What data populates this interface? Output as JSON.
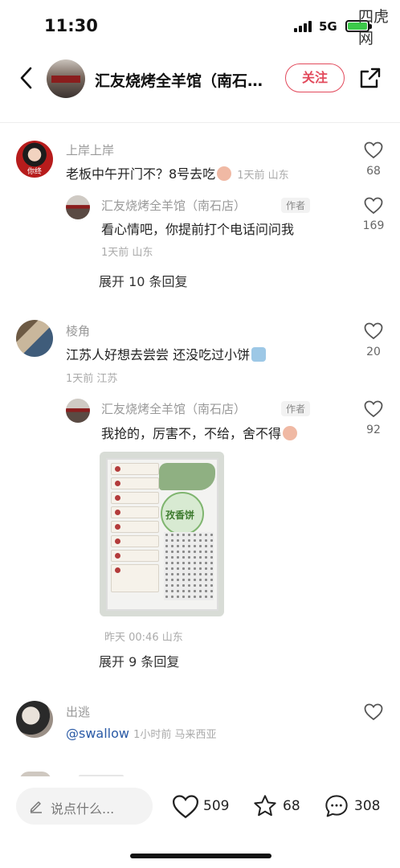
{
  "status_bar": {
    "time": "11:30",
    "network": "5G"
  },
  "watermark": "四虎网",
  "header": {
    "title": "汇友烧烤全羊馆（南石…",
    "follow_label": "关注"
  },
  "comments": [
    {
      "username": "上岸上岸",
      "avatar_text": "你终",
      "text_before": "老板中午开门不？8号去吃",
      "time_location": "1天前 山东",
      "likes": "68",
      "reply": {
        "username": "汇友烧烤全羊馆（南石店）",
        "author_tag": "作者",
        "text": "看心情吧，你提前打个电话问问我",
        "time_location": "1天前 山东",
        "likes": "169"
      },
      "expand": "展开 10 条回复"
    },
    {
      "username": "棱角",
      "text_before": "江苏人好想去尝尝 还没吃过小饼",
      "time_location": "1天前 江苏",
      "likes": "20",
      "reply": {
        "username": "汇友烧烤全羊馆（南石店）",
        "author_tag": "作者",
        "text": "我抢的，厉害不，不给，舍不得",
        "time_location": "昨天 00:46 山东",
        "likes": "92",
        "photo_text": "孜香饼"
      },
      "expand": "展开 9 条回复"
    },
    {
      "username": "出逃",
      "mention": "@swallow",
      "time_location": "1小时前 马来西亚"
    }
  ],
  "bottom_bar": {
    "input_placeholder": "说点什么...",
    "likes": "509",
    "favorites": "68",
    "comments": "308"
  },
  "colors": {
    "accent": "#e24a5c",
    "muted": "#999999"
  }
}
